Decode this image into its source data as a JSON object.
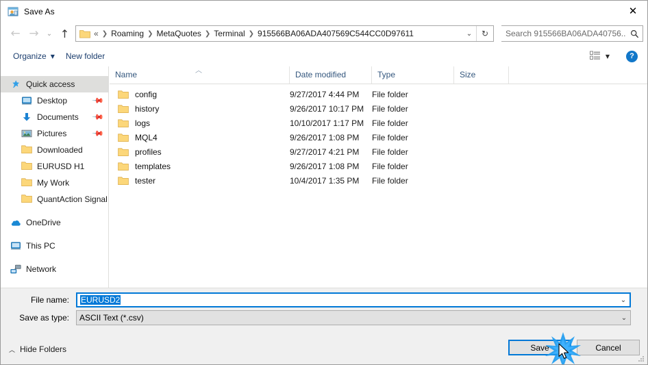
{
  "window": {
    "title": "Save As",
    "title_icon": "save-as-window-icon",
    "close_label": "✕"
  },
  "nav": {
    "back_icon": "arrow-left-icon",
    "forward_icon": "arrow-right-icon",
    "recent_icon": "chevron-down-icon",
    "up_icon": "arrow-up-icon",
    "address": {
      "folder_icon": "folder-icon",
      "crumbs": [
        "«",
        "Roaming",
        "MetaQuotes",
        "Terminal",
        "915566BA06ADA407569C544CC0D97611"
      ],
      "separator": "❯",
      "dropdown_icon": "chevron-down-icon",
      "refresh_icon": "refresh-icon"
    },
    "search": {
      "placeholder": "Search 915566BA06ADA40756...",
      "icon": "search-icon"
    }
  },
  "commandbar": {
    "organize": "Organize",
    "organize_caret": "▼",
    "new_folder": "New folder",
    "view_icon": "view-details-icon",
    "view_caret": "▼",
    "help_label": "?"
  },
  "sidebar": {
    "items": [
      {
        "label": "Quick access",
        "icon": "star-pin-icon",
        "level": "root",
        "selected": true,
        "pinned": false
      },
      {
        "label": "Desktop",
        "icon": "desktop-icon",
        "level": "child",
        "selected": false,
        "pinned": true
      },
      {
        "label": "Documents",
        "icon": "documents-icon",
        "level": "child",
        "selected": false,
        "pinned": true
      },
      {
        "label": "Pictures",
        "icon": "pictures-icon",
        "level": "child",
        "selected": false,
        "pinned": true
      },
      {
        "label": "Downloaded",
        "icon": "folder-icon",
        "level": "child",
        "selected": false,
        "pinned": false
      },
      {
        "label": "EURUSD H1",
        "icon": "folder-icon",
        "level": "child",
        "selected": false,
        "pinned": false
      },
      {
        "label": "My Work",
        "icon": "folder-icon",
        "level": "child",
        "selected": false,
        "pinned": false
      },
      {
        "label": "QuantAction Signal",
        "icon": "folder-icon",
        "level": "child",
        "selected": false,
        "pinned": false
      },
      {
        "label": "OneDrive",
        "icon": "onedrive-icon",
        "level": "root",
        "selected": false,
        "pinned": false,
        "gap_before": true
      },
      {
        "label": "This PC",
        "icon": "this-pc-icon",
        "level": "root",
        "selected": false,
        "pinned": false,
        "gap_before": true
      },
      {
        "label": "Network",
        "icon": "network-icon",
        "level": "root",
        "selected": false,
        "pinned": false,
        "gap_before": true
      }
    ]
  },
  "filelist": {
    "columns": [
      "Name",
      "Date modified",
      "Type",
      "Size"
    ],
    "sort_column": "Name",
    "sort_caret": "︿",
    "rows": [
      {
        "name": "config",
        "date": "9/27/2017 4:44 PM",
        "type": "File folder",
        "size": "",
        "icon": "folder-icon"
      },
      {
        "name": "history",
        "date": "9/26/2017 10:17 PM",
        "type": "File folder",
        "size": "",
        "icon": "folder-icon"
      },
      {
        "name": "logs",
        "date": "10/10/2017 1:17 PM",
        "type": "File folder",
        "size": "",
        "icon": "folder-icon"
      },
      {
        "name": "MQL4",
        "date": "9/26/2017 1:08 PM",
        "type": "File folder",
        "size": "",
        "icon": "folder-icon"
      },
      {
        "name": "profiles",
        "date": "9/27/2017 4:21 PM",
        "type": "File folder",
        "size": "",
        "icon": "folder-icon"
      },
      {
        "name": "templates",
        "date": "9/26/2017 1:08 PM",
        "type": "File folder",
        "size": "",
        "icon": "folder-icon"
      },
      {
        "name": "tester",
        "date": "10/4/2017 1:35 PM",
        "type": "File folder",
        "size": "",
        "icon": "folder-icon"
      }
    ]
  },
  "form": {
    "filename_label": "File name:",
    "filename_value": "EURUSD2",
    "filename_selected": true,
    "filetype_label": "Save as type:",
    "filetype_value": "ASCII Text (*.csv)",
    "dropdown_icon": "chevron-down-icon"
  },
  "footer": {
    "hide_folders": "Hide Folders",
    "hide_folders_caret": "︿",
    "save": "Save",
    "cancel": "Cancel"
  },
  "colors": {
    "accent": "#0078d7",
    "folder": "#fcd77a",
    "link_text": "#1c3e6e",
    "header_text": "#33567d",
    "help_blue": "#1177c9",
    "footer_bg": "#f0f0f0"
  }
}
